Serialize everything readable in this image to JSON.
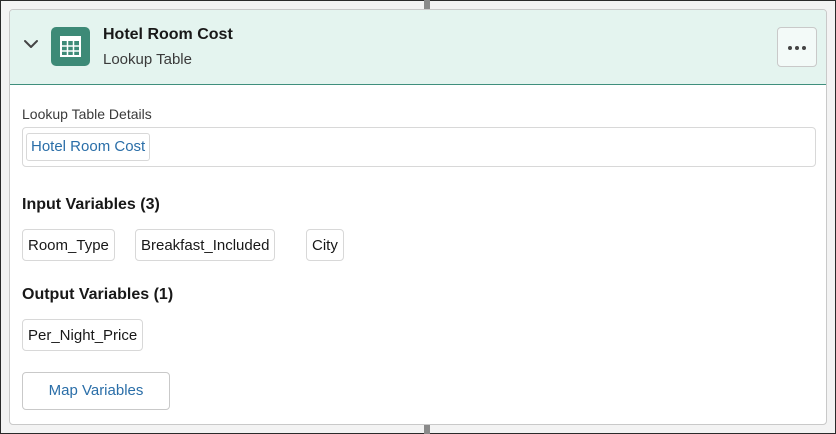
{
  "element": {
    "title": "Hotel Room Cost",
    "type_label": "Lookup Table",
    "icon": "table-icon",
    "menu_icon": "more-actions-icon",
    "collapse_icon": "chevron-down-icon"
  },
  "details": {
    "label": "Lookup Table Details",
    "lookup_value": "Hotel Room Cost"
  },
  "inputs": {
    "heading": "Input Variables (3)",
    "items": [
      "Room_Type",
      "Breakfast_Included",
      "City"
    ]
  },
  "outputs": {
    "heading": "Output Variables (1)",
    "items": [
      "Per_Night_Price"
    ]
  },
  "actions": {
    "map_label": "Map Variables"
  },
  "colors": {
    "header_bg": "#e4f4ef",
    "icon_tile": "#3d8a77",
    "link": "#2a6ea8"
  }
}
